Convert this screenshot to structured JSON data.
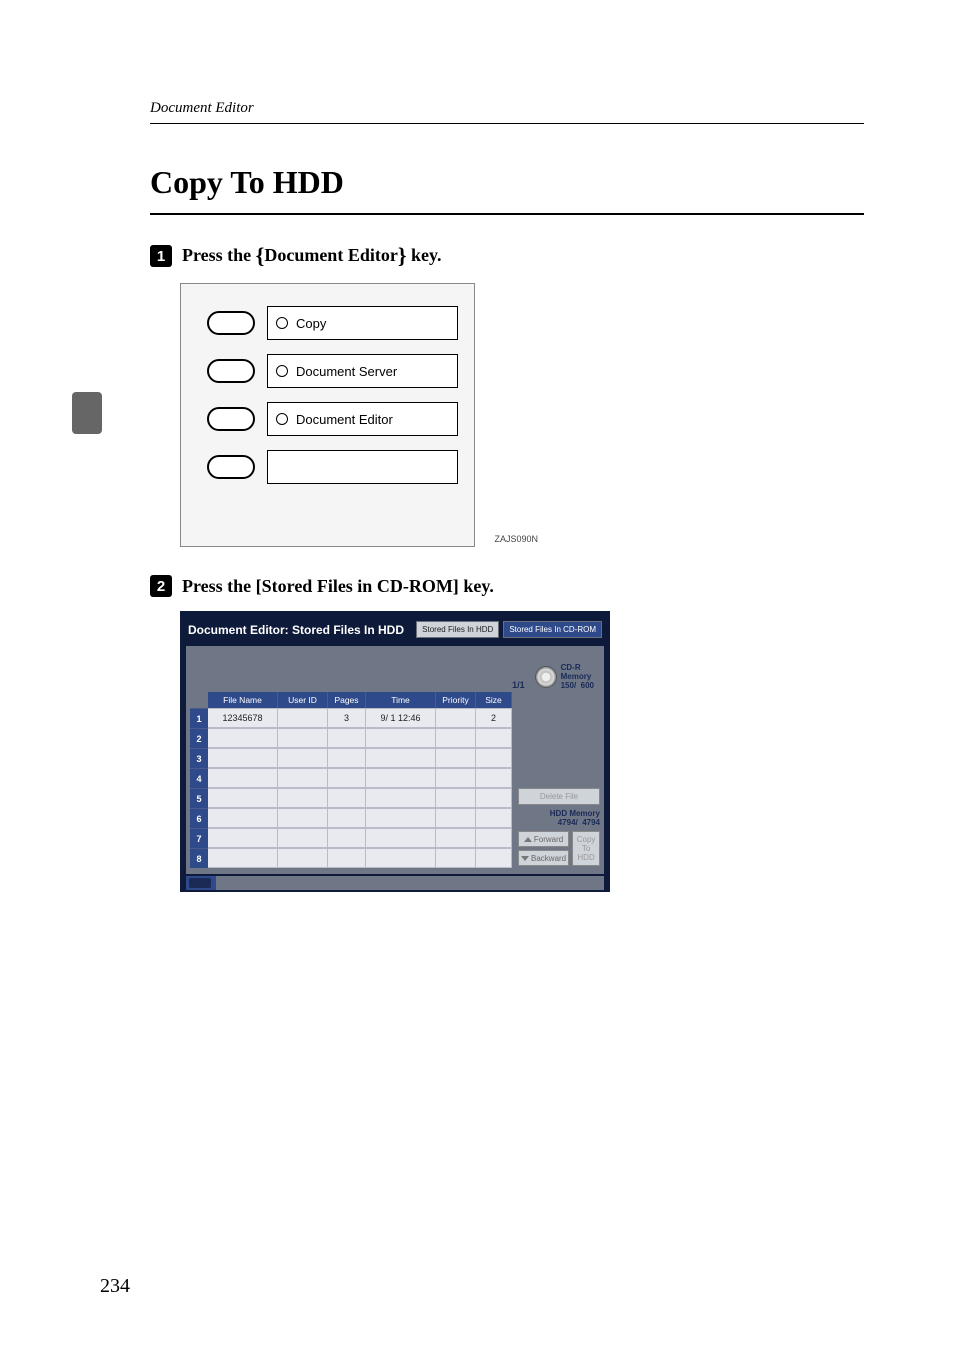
{
  "running_head": "Document Editor",
  "section_title": "Copy To HDD",
  "page_number": "234",
  "step1": {
    "prefix": "Press the ",
    "keyname": "Document Editor",
    "suffix": " key."
  },
  "panel": {
    "labels": [
      "Copy",
      "Document Server",
      "Document Editor",
      ""
    ],
    "code": "ZAJS090N"
  },
  "step2": {
    "prefix": "Press the ",
    "btn": "[Stored Files in CD-ROM]",
    "suffix": " key."
  },
  "screen": {
    "title": "Document Editor: Stored Files In HDD",
    "tabs": {
      "hdd": "Stored Files In HDD",
      "cd": "Stored Files In CD-ROM"
    },
    "page_ind": "1/1",
    "cd": {
      "l1": "CD-R",
      "l2": "Memory",
      "cur": "150/",
      "max": "600"
    },
    "headers": [
      "",
      "File Name",
      "User ID",
      "Pages",
      "Time",
      "Priority",
      "Size"
    ],
    "rows": [
      {
        "idx": "1",
        "file": "12345678",
        "user": "",
        "pages": "3",
        "time": "9/  1  12:46",
        "priority": "",
        "size": "2"
      },
      {
        "idx": "2"
      },
      {
        "idx": "3"
      },
      {
        "idx": "4"
      },
      {
        "idx": "5"
      },
      {
        "idx": "6"
      },
      {
        "idx": "7"
      },
      {
        "idx": "8"
      }
    ],
    "side": {
      "delete": "Delete File",
      "mem_label": "HDD Memory",
      "mem_cur": "4794/",
      "mem_max": "4794",
      "fwd": "Forward",
      "back": "Backward",
      "copy": "Copy To HDD"
    }
  }
}
